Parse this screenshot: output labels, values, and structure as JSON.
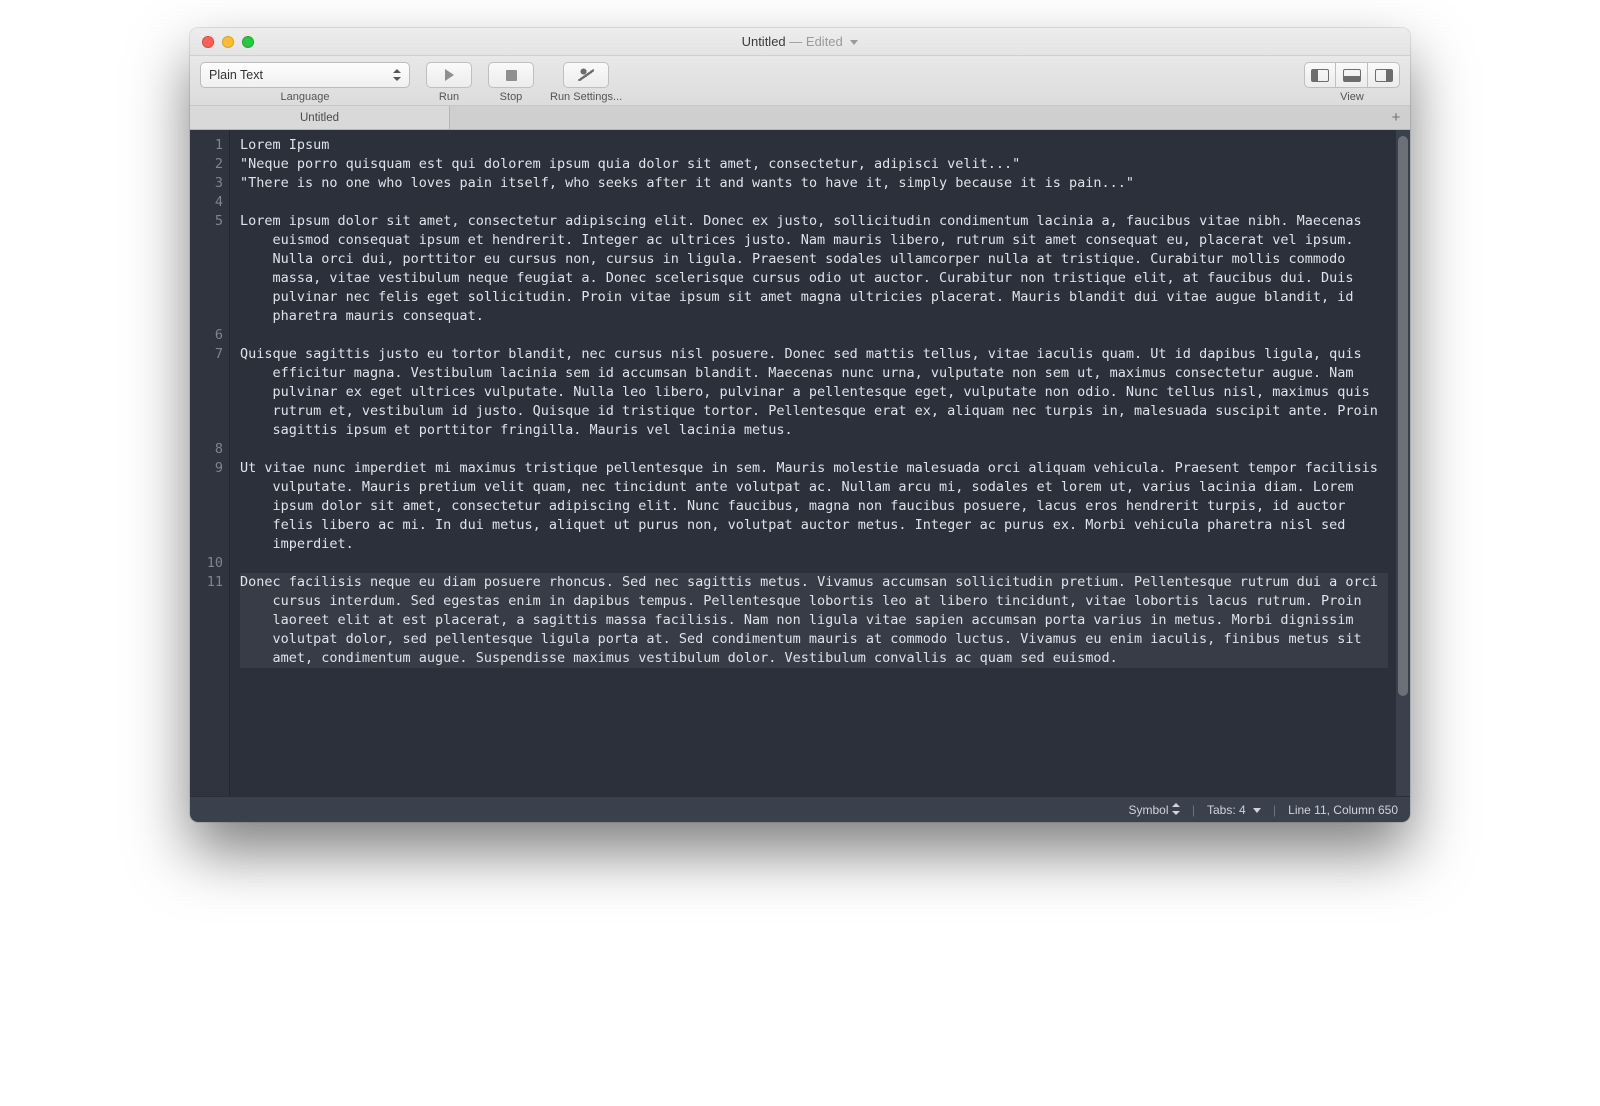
{
  "title": {
    "document": "Untitled",
    "state": "Edited"
  },
  "toolbar": {
    "language": {
      "value": "Plain Text",
      "label": "Language"
    },
    "run": {
      "label": "Run"
    },
    "stop": {
      "label": "Stop"
    },
    "settings": {
      "label": "Run Settings..."
    },
    "view": {
      "label": "View"
    }
  },
  "tabs": [
    {
      "label": "Untitled"
    }
  ],
  "editor": {
    "line_numbers": [
      "1",
      "2",
      "3",
      "4",
      "5",
      "6",
      "7",
      "8",
      "9",
      "10",
      "11"
    ],
    "lines": [
      "Lorem Ipsum",
      "\"Neque porro quisquam est qui dolorem ipsum quia dolor sit amet, consectetur, adipisci velit...\"",
      "\"There is no one who loves pain itself, who seeks after it and wants to have it, simply because it is pain...\"",
      "",
      "Lorem ipsum dolor sit amet, consectetur adipiscing elit. Donec ex justo, sollicitudin condimentum lacinia a, faucibus vitae nibh. Maecenas euismod consequat ipsum et hendrerit. Integer ac ultrices justo. Nam mauris libero, rutrum sit amet consequat eu, placerat vel ipsum. Nulla orci dui, porttitor eu cursus non, cursus in ligula. Praesent sodales ullamcorper nulla at tristique. Curabitur mollis commodo massa, vitae vestibulum neque feugiat a. Donec scelerisque cursus odio ut auctor. Curabitur non tristique elit, at faucibus dui. Duis pulvinar nec felis eget sollicitudin. Proin vitae ipsum sit amet magna ultricies placerat. Mauris blandit dui vitae augue blandit, id pharetra mauris consequat.",
      "",
      "Quisque sagittis justo eu tortor blandit, nec cursus nisl posuere. Donec sed mattis tellus, vitae iaculis quam. Ut id dapibus ligula, quis efficitur magna. Vestibulum lacinia sem id accumsan blandit. Maecenas nunc urna, vulputate non sem ut, maximus consectetur augue. Nam pulvinar ex eget ultrices vulputate. Nulla leo libero, pulvinar a pellentesque eget, vulputate non odio. Nunc tellus nisl, maximus quis rutrum et, vestibulum id justo. Quisque id tristique tortor. Pellentesque erat ex, aliquam nec turpis in, malesuada suscipit ante. Proin sagittis ipsum et porttitor fringilla. Mauris vel lacinia metus.",
      "",
      "Ut vitae nunc imperdiet mi maximus tristique pellentesque in sem. Mauris molestie malesuada orci aliquam vehicula. Praesent tempor facilisis vulputate. Mauris pretium velit quam, nec tincidunt ante volutpat ac. Nullam arcu mi, sodales et lorem ut, varius lacinia diam. Lorem ipsum dolor sit amet, consectetur adipiscing elit. Nunc faucibus, magna non faucibus posuere, lacus eros hendrerit turpis, id auctor felis libero ac mi. In dui metus, aliquet ut purus non, volutpat auctor metus. Integer ac purus ex. Morbi vehicula pharetra nisl sed imperdiet.",
      "",
      "Donec facilisis neque eu diam posuere rhoncus. Sed nec sagittis metus. Vivamus accumsan sollicitudin pretium. Pellentesque rutrum dui a orci cursus interdum. Sed egestas enim in dapibus tempus. Pellentesque lobortis leo at libero tincidunt, vitae lobortis lacus rutrum. Proin laoreet elit at est placerat, a sagittis massa facilisis. Nam non ligula vitae sapien accumsan porta varius in metus. Morbi dignissim volutpat dolor, sed pellentesque ligula porta at. Sed condimentum mauris at commodo luctus. Vivamus eu enim iaculis, finibus metus sit amet, condimentum augue. Suspendisse maximus vestibulum dolor. Vestibulum convallis ac quam sed euismod."
    ],
    "current_line_index": 10
  },
  "status": {
    "symbol": "Symbol",
    "tabs": "Tabs: 4",
    "cursor": "Line 11, Column 650"
  }
}
